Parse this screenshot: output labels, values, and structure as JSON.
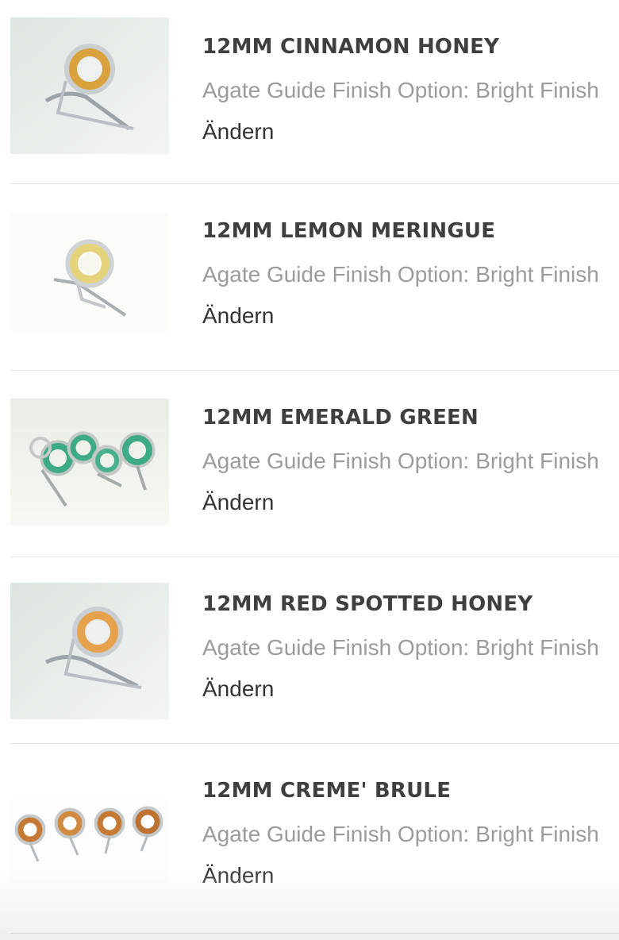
{
  "items": [
    {
      "name": "12MM CINNAMON HONEY",
      "option_label": "Agate Guide Finish Option:",
      "option_value": "Bright Finish",
      "change_label": "Ändern",
      "stone_color": "#d9a23c"
    },
    {
      "name": "12MM LEMON MERINGUE",
      "option_label": "Agate Guide Finish Option:",
      "option_value": "Bright Finish",
      "change_label": "Ändern",
      "stone_color": "#e6d27a"
    },
    {
      "name": "12MM EMERALD GREEN",
      "option_label": "Agate Guide Finish Option:",
      "option_value": "Bright Finish",
      "change_label": "Ändern",
      "stone_color": "#3faa86"
    },
    {
      "name": "12MM RED SPOTTED HONEY",
      "option_label": "Agate Guide Finish Option:",
      "option_value": "Bright Finish",
      "change_label": "Ändern",
      "stone_color": "#e5a14b"
    },
    {
      "name": "12MM CREME' BRULE",
      "option_label": "Agate Guide Finish Option:",
      "option_value": "Bright Finish",
      "change_label": "Ändern",
      "stone_color": "#c47a35"
    }
  ]
}
